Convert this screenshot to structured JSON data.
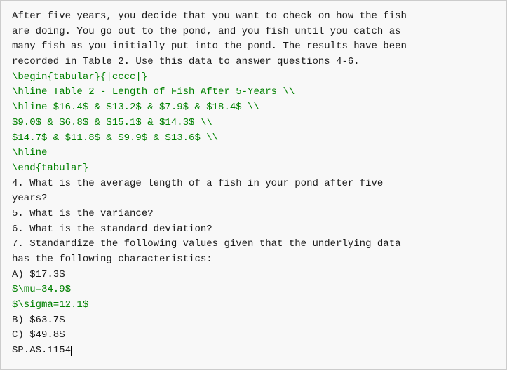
{
  "content": {
    "lines": [
      {
        "text": "After five years, you decide that you want to check on how the fish",
        "type": "black"
      },
      {
        "text": "are doing. You go out to the pond, and you fish until you catch as",
        "type": "black"
      },
      {
        "text": "many fish as you initially put into the pond. The results have been",
        "type": "black"
      },
      {
        "text": "recorded in Table 2. Use this data to answer questions 4-6.",
        "type": "black"
      },
      {
        "text": "\\begin{tabular}{|cccc|}",
        "type": "green"
      },
      {
        "text": "\\hline Table 2 - Length of Fish After 5-Years \\\\",
        "type": "green"
      },
      {
        "text": "\\hline $16.4$ & $13.2$ & $7.9$ & $18.4$ \\\\",
        "type": "green"
      },
      {
        "text": "$9.0$ & $6.8$ & $15.1$ & $14.3$ \\\\",
        "type": "green"
      },
      {
        "text": "$14.7$ & $11.8$ & $9.9$ & $13.6$ \\\\",
        "type": "green"
      },
      {
        "text": "\\hline",
        "type": "green"
      },
      {
        "text": "\\end{tabular}",
        "type": "green"
      },
      {
        "text": "4. What is the average length of a fish in your pond after five",
        "type": "black"
      },
      {
        "text": "years?",
        "type": "black"
      },
      {
        "text": "5. What is the variance?",
        "type": "black"
      },
      {
        "text": "6. What is the standard deviation?",
        "type": "black"
      },
      {
        "text": "7. Standardize the following values given that the underlying data",
        "type": "black"
      },
      {
        "text": "has the following characteristics:",
        "type": "black"
      },
      {
        "text": "A) $17.3$",
        "type": "black"
      },
      {
        "text": "$\\mu=34.9$",
        "type": "green"
      },
      {
        "text": "$\\sigma=12.1$",
        "type": "green"
      },
      {
        "text": "B) $63.7$",
        "type": "black"
      },
      {
        "text": "C) $49.8$",
        "type": "black"
      },
      {
        "text": "SP.AS.1154",
        "type": "black",
        "cursor": true
      }
    ]
  }
}
